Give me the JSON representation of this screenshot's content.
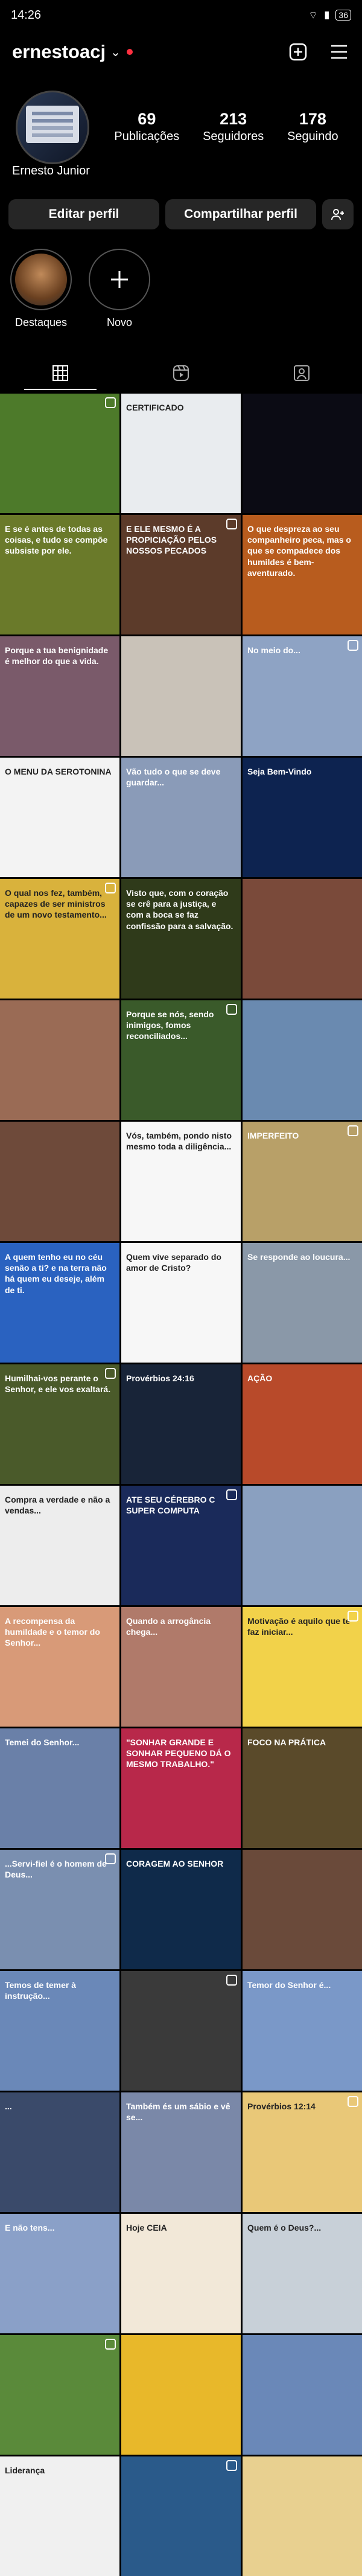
{
  "status_bar": {
    "time": "14:26",
    "battery": "36"
  },
  "header": {
    "username": "ernestoacj"
  },
  "profile": {
    "stats": [
      {
        "value": "69",
        "label": "Publicações"
      },
      {
        "value": "213",
        "label": "Seguidores"
      },
      {
        "value": "178",
        "label": "Seguindo"
      }
    ],
    "full_name": "Ernesto Junior"
  },
  "actions": {
    "edit": "Editar perfil",
    "share": "Compartilhar perfil"
  },
  "highlights": [
    {
      "label": "Destaques"
    },
    {
      "label": "Novo"
    }
  ],
  "colors": {
    "background": "#000000",
    "button": "#262626",
    "notification": "#ff3040"
  },
  "posts": [
    {
      "bg": "#4d7a2a",
      "text": ""
    },
    {
      "bg": "#e9ecef",
      "text": "CERTIFICADO",
      "dark": true
    },
    {
      "bg": "#0b0b14",
      "text": ""
    },
    {
      "bg": "#6a7a2a",
      "text": "E se é antes de todas as coisas, e tudo se compõe subsiste por ele."
    },
    {
      "bg": "#5c3b2a",
      "text": "E ELE MESMO É A PROPICIAÇÃO PELOS NOSSOS PECADOS"
    },
    {
      "bg": "#b85c1e",
      "text": "O que despreza ao seu companheiro peca, mas o que se compadece dos humildes é bem-aventurado."
    },
    {
      "bg": "#7a5a6a",
      "text": "Porque a tua benignidade é melhor do que a vida."
    },
    {
      "bg": "#c9c2b8",
      "text": "",
      "dark": true
    },
    {
      "bg": "#8ea3c4",
      "text": "No meio do..."
    },
    {
      "bg": "#f3f3f3",
      "text": "O MENU DA SEROTONINA",
      "dark": true
    },
    {
      "bg": "#8a9bb8",
      "text": "Vão tudo o que se deve guardar..."
    },
    {
      "bg": "#0d2350",
      "text": "Seja Bem-Vindo"
    },
    {
      "bg": "#d9b23c",
      "text": "O qual nos fez, também, capazes de ser ministros de um novo testamento...",
      "dark": true
    },
    {
      "bg": "#2f3a1a",
      "text": "Visto que, com o coração se crê para a justiça, e com a boca se faz confissão para a salvação."
    },
    {
      "bg": "#7a4a3a",
      "text": ""
    },
    {
      "bg": "#9a6b55",
      "text": ""
    },
    {
      "bg": "#3a5a2a",
      "text": "Porque se nós, sendo inimigos, fomos reconciliados..."
    },
    {
      "bg": "#6a8ab0",
      "text": ""
    },
    {
      "bg": "#6e4a3a",
      "text": ""
    },
    {
      "bg": "#f7f7f7",
      "text": "Vós, também, pondo nisto mesmo toda a diligência...",
      "dark": true
    },
    {
      "bg": "#b8a068",
      "text": "IMPERFEITO"
    },
    {
      "bg": "#2a62c0",
      "text": "A quem tenho eu no céu senão a ti? e na terra não há quem eu deseje, além de ti."
    },
    {
      "bg": "#f7f7f7",
      "text": "Quem vive separado do amor de Cristo?",
      "dark": true
    },
    {
      "bg": "#8a98a8",
      "text": "Se responde ao loucura..."
    },
    {
      "bg": "#4a5a2a",
      "text": "Humilhai-vos perante o Senhor, e ele vos exaltará."
    },
    {
      "bg": "#182438",
      "text": "Provérbios 24:16"
    },
    {
      "bg": "#b84a2a",
      "text": "AÇÃO"
    },
    {
      "bg": "#ededed",
      "text": "Compra a verdade e não a vendas...",
      "dark": true
    },
    {
      "bg": "#1a2a5a",
      "text": "ATE SEU CÉREBRO C SUPER COMPUTA"
    },
    {
      "bg": "#8aa0c0",
      "text": ""
    },
    {
      "bg": "#d89a78",
      "text": "A recompensa da humildade e o temor do Senhor..."
    },
    {
      "bg": "#b07a6a",
      "text": "Quando a arrogância chega..."
    },
    {
      "bg": "#f2d24a",
      "text": "Motivação é aquilo que te faz iniciar...",
      "dark": true
    },
    {
      "bg": "#6a80a8",
      "text": "Temei do Senhor..."
    },
    {
      "bg": "#b8284a",
      "text": "\"SONHAR GRANDE E SONHAR PEQUENO DÁ O MESMO TRABALHO.\""
    },
    {
      "bg": "#5a4a2a",
      "text": "FOCO NA PRÁTICA"
    },
    {
      "bg": "#7a8fb0",
      "text": "...Servi-fiel é o homem de Deus..."
    },
    {
      "bg": "#0f2a4a",
      "text": "CORAGEM AO SENHOR"
    },
    {
      "bg": "#6a4a3a",
      "text": ""
    },
    {
      "bg": "#6a88b8",
      "text": "Temos de temer à instrução..."
    },
    {
      "bg": "#3a3a3a",
      "text": ""
    },
    {
      "bg": "#7a98c8",
      "text": "Temor do Senhor é..."
    },
    {
      "bg": "#3a4a6a",
      "text": "..."
    },
    {
      "bg": "#7a88a8",
      "text": "Também és um sábio e vê se..."
    },
    {
      "bg": "#e9c878",
      "text": "Provérbios 12:14",
      "dark": true
    },
    {
      "bg": "#8aa0c8",
      "text": "E não tens..."
    },
    {
      "bg": "#f2e8d8",
      "text": "Hoje CEIA",
      "dark": true
    },
    {
      "bg": "#c8d0d8",
      "text": "Quem é o Deus?...",
      "dark": true
    },
    {
      "bg": "#5a8a3a",
      "text": ""
    },
    {
      "bg": "#e8b82a",
      "text": ""
    },
    {
      "bg": "#6a88b8",
      "text": ""
    },
    {
      "bg": "#f0f0f0",
      "text": "Liderança",
      "dark": true
    },
    {
      "bg": "#2a5a8a",
      "text": ""
    },
    {
      "bg": "#e8d090",
      "text": ""
    }
  ]
}
